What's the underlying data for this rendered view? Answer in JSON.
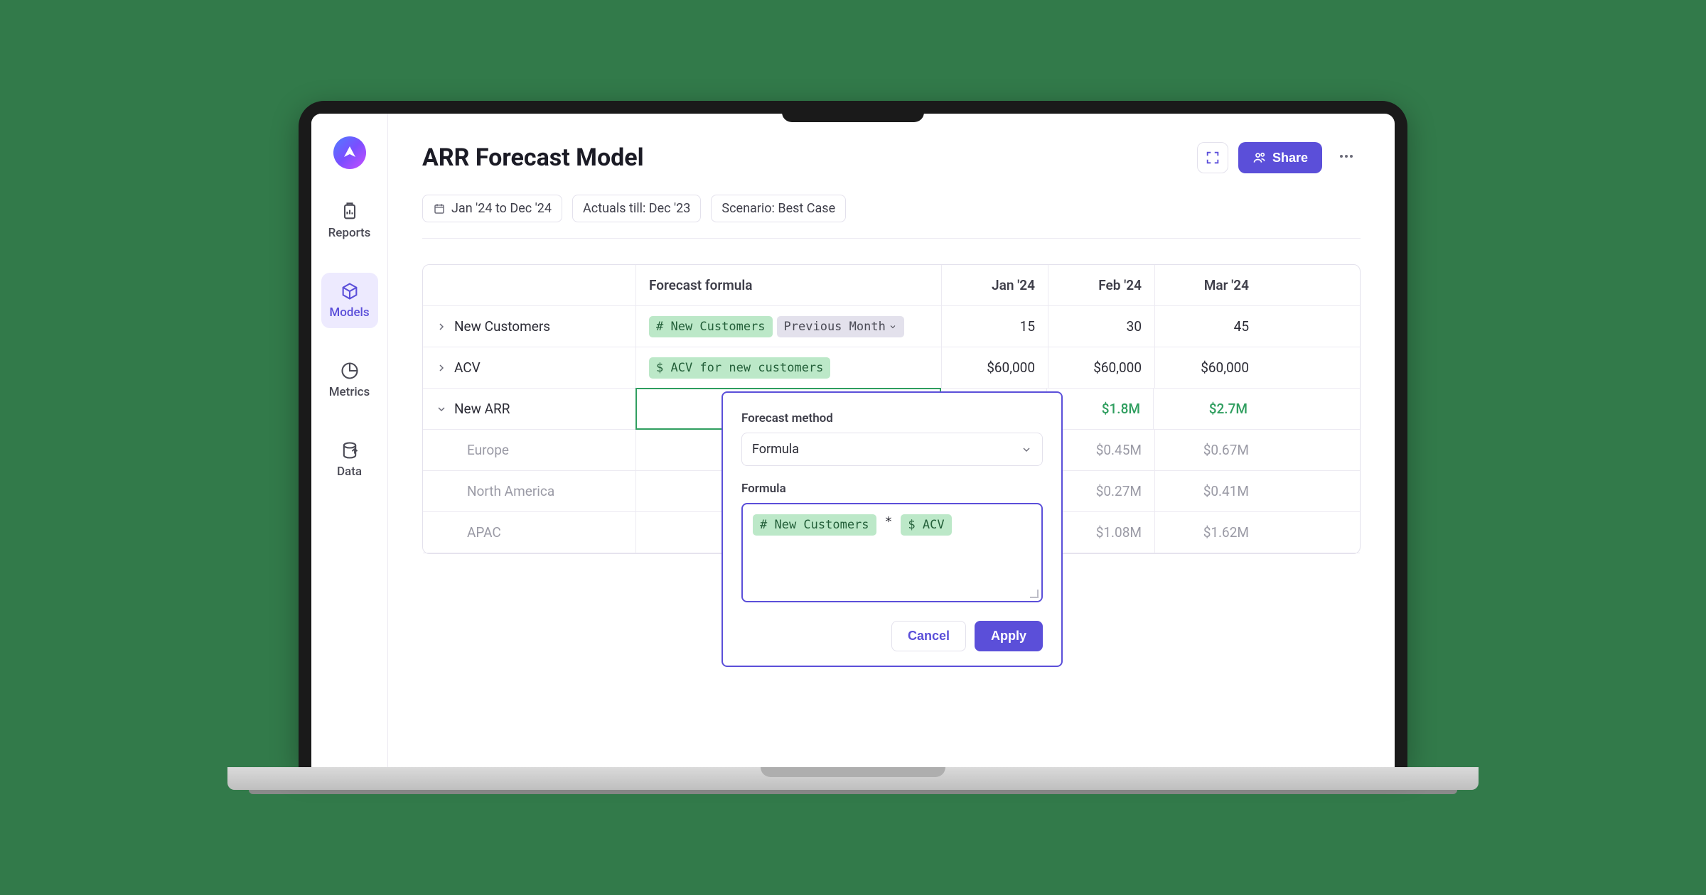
{
  "header": {
    "title": "ARR Forecast Model",
    "share_label": "Share"
  },
  "chips": {
    "date_range": "Jan '24 to Dec '24",
    "actuals": "Actuals till: Dec '23",
    "scenario": "Scenario: Best Case"
  },
  "sidebar": {
    "items": [
      {
        "label": "Reports"
      },
      {
        "label": "Models"
      },
      {
        "label": "Metrics"
      },
      {
        "label": "Data"
      }
    ]
  },
  "table": {
    "columns": {
      "formula": "Forecast formula",
      "m1": "Jan '24",
      "m2": "Feb '24",
      "m3": "Mar '24"
    },
    "rows": {
      "new_customers": {
        "label": "New Customers",
        "token_hash": "# New Customers",
        "token_prev": "Previous Month",
        "v1": "15",
        "v2": "30",
        "v3": "45"
      },
      "acv": {
        "label": "ACV",
        "token_dollar": "$ ACV for new customers",
        "v1": "$60,000",
        "v2": "$60,000",
        "v3": "$60,000"
      },
      "new_arr": {
        "label": "New ARR",
        "v2": "$1.8M",
        "v3": "$2.7M"
      },
      "europe": {
        "label": "Europe",
        "v2": "$0.45M",
        "v3": "$0.67M"
      },
      "north_america": {
        "label": "North America",
        "v2": "$0.27M",
        "v3": "$0.41M"
      },
      "apac": {
        "label": "APAC",
        "v2": "$1.08M",
        "v3": "$1.62M"
      }
    }
  },
  "popover": {
    "method_label": "Forecast method",
    "method_value": "Formula",
    "formula_label": "Formula",
    "token_customers": "# New Customers",
    "op": "*",
    "token_acv": "$ ACV",
    "cancel": "Cancel",
    "apply": "Apply"
  }
}
